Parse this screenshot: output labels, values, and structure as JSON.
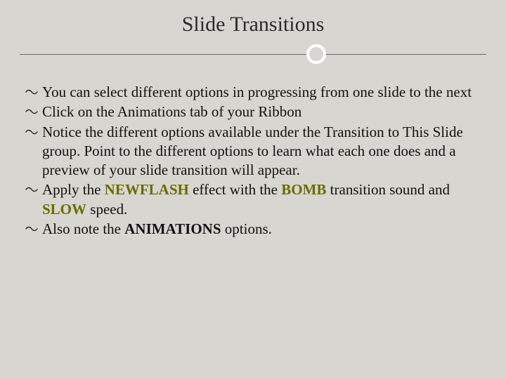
{
  "slide": {
    "title": "Slide Transitions",
    "bullets": [
      {
        "segments": [
          {
            "text": "You can select different options in progressing from one slide to the next",
            "style": "normal"
          }
        ]
      },
      {
        "segments": [
          {
            "text": "Click on the Animations tab of your Ribbon",
            "style": "normal"
          }
        ]
      },
      {
        "segments": [
          {
            "text": "Notice the different options available under the Transition to This Slide group.  Point to the different options to learn what each one does and a preview of your slide transition will appear.",
            "style": "normal"
          }
        ]
      },
      {
        "segments": [
          {
            "text": "Apply the ",
            "style": "normal"
          },
          {
            "text": "NEWFLASH",
            "style": "bold-olive"
          },
          {
            "text": " effect with the ",
            "style": "normal"
          },
          {
            "text": "BOMB",
            "style": "bold-olive"
          },
          {
            "text": " transition sound and ",
            "style": "normal"
          },
          {
            "text": "SLOW",
            "style": "bold-olive"
          },
          {
            "text": " speed.",
            "style": "normal"
          }
        ]
      },
      {
        "segments": [
          {
            "text": "Also note the ",
            "style": "normal"
          },
          {
            "text": "ANIMATIONS",
            "style": "bold"
          },
          {
            "text": " options.",
            "style": "normal"
          }
        ]
      }
    ]
  }
}
